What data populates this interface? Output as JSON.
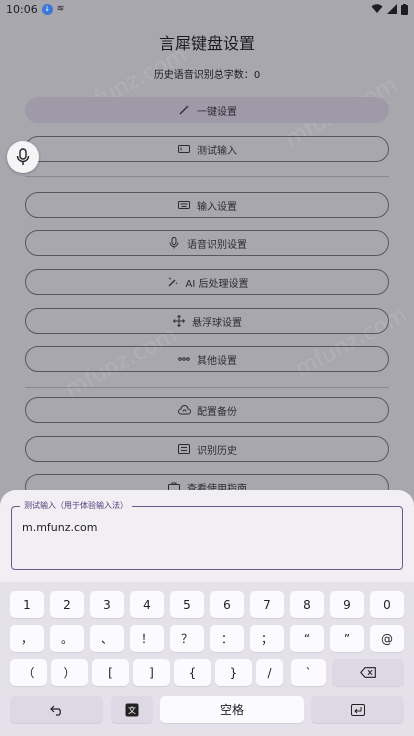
{
  "status": {
    "time": "10:06"
  },
  "title": "言犀键盘设置",
  "history_count": {
    "label": "历史语音识别总字数：",
    "value": "0"
  },
  "buttons": {
    "one_click": "一键设置",
    "test_input": "测试输入",
    "input_settings": "输入设置",
    "voice_settings": "语音识别设置",
    "ai_settings": "AI 后处理设置",
    "float_settings": "悬浮球设置",
    "other_settings": "其他设置",
    "backup": "配置备份",
    "history": "识别历史",
    "guide": "查看使用指南"
  },
  "test_field": {
    "label": "测试输入（用于体验输入法）",
    "value": "m.mfunz.com"
  },
  "keyboard": {
    "row1": [
      "1",
      "2",
      "3",
      "4",
      "5",
      "6",
      "7",
      "8",
      "9",
      "0"
    ],
    "row2": [
      "，",
      "。",
      "、",
      "！",
      "？",
      "：",
      "；",
      "“",
      "”",
      "@"
    ],
    "row3": [
      "（",
      "）",
      "[",
      "]",
      "{",
      "}",
      "/",
      "`"
    ],
    "space": "空格"
  },
  "watermark": "mfunz.com",
  "colors": {
    "accent": "#6a5a8e",
    "scrim": "#a9a7ae",
    "sheet": "#f1eef4"
  }
}
